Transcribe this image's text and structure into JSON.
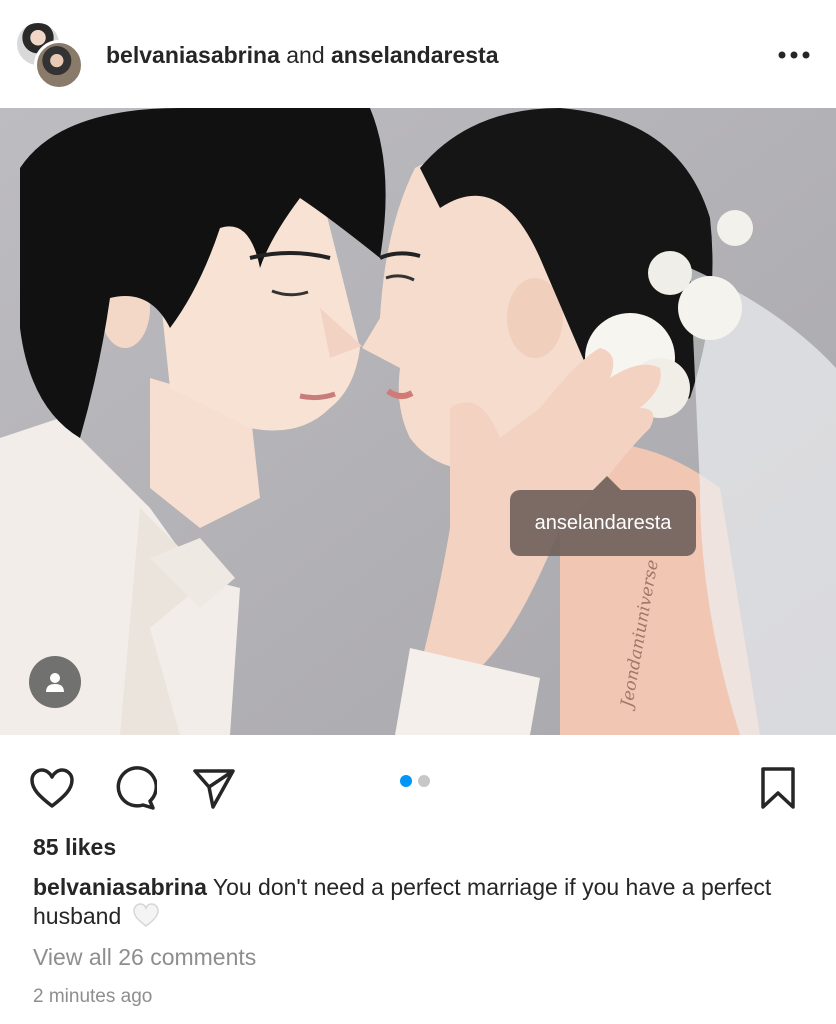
{
  "post": {
    "author": "belvaniasabrina",
    "conjunction": "and",
    "coauthor": "anselandaresta",
    "tag_label": "anselandaresta",
    "watermark": "Jeondaniuniverse",
    "likes": "85 likes",
    "caption_user": "belvaniasabrina",
    "caption_text": "You don't need a perfect marriage if you have a perfect husband",
    "view_comments": "View all 26 comments",
    "timestamp": "2 minutes ago",
    "carousel_pages": 2,
    "carousel_current": 1
  },
  "icons": {
    "more": "more-horizontal-icon",
    "like": "heart-outline-icon",
    "comment": "comment-bubble-icon",
    "share": "paper-plane-icon",
    "save": "bookmark-outline-icon",
    "user_tags": "person-icon",
    "caption_emoji": "white-heart-icon"
  },
  "colors": {
    "text": "#262626",
    "muted": "#8e8e8e",
    "accent_dot": "#0095f6",
    "inactive_dot": "#c7c7c7",
    "tag_bg": "#70625c"
  }
}
